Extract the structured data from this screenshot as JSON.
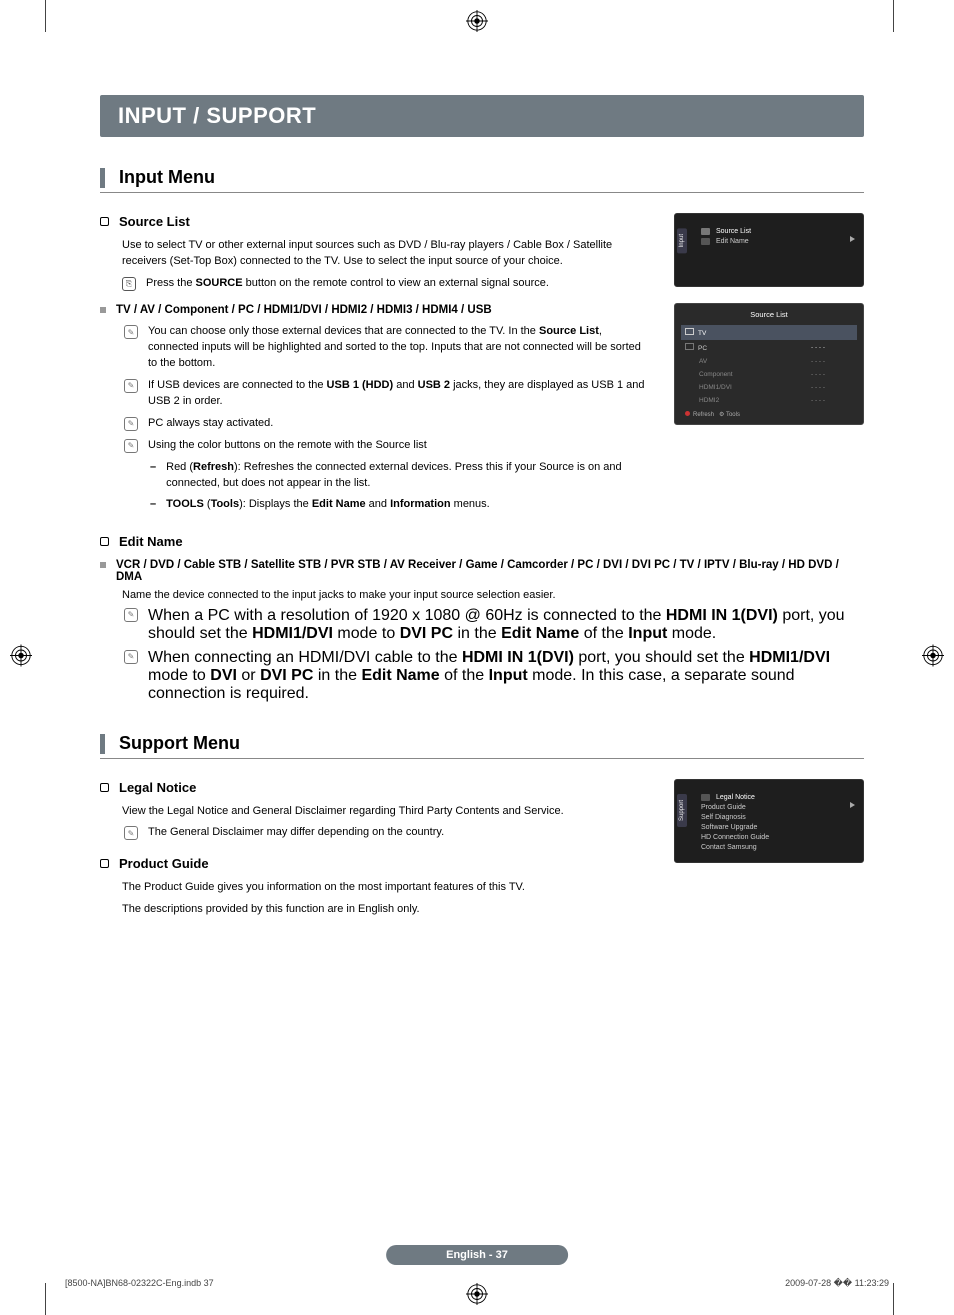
{
  "chapter_title": "INPUT / SUPPORT",
  "section1": {
    "title": "Input Menu",
    "sub1": {
      "heading": "Source List",
      "desc": "Use to select TV or other external input sources such as DVD / Blu-ray players / Cable Box / Satellite receivers (Set-Top Box) connected to the TV. Use to select the input source of your choice.",
      "press_prefix": "Press the ",
      "press_bold": "SOURCE",
      "press_suffix": " button on the remote control to view an external signal source."
    },
    "sub2": {
      "heading": "TV / AV / Component / PC / HDMI1/DVI / HDMI2 / HDMI3 / HDMI4 / USB",
      "n1a": "You can choose only those external devices that are connected to the TV. In the ",
      "n1b": "Source List",
      "n1c": ", connected inputs will be highlighted and sorted to the top. Inputs that are not connected will be sorted to the bottom.",
      "n2a": "If USB devices are connected to the ",
      "n2b": "USB 1 (HDD)",
      "n2c": " and ",
      "n2d": "USB 2",
      "n2e": " jacks, they are displayed as USB 1 and USB 2 in order.",
      "n3": "PC always stay activated.",
      "n4": "Using the color buttons on the remote with the Source list",
      "d1a": "Red (",
      "d1b": "Refresh",
      "d1c": "): Refreshes the connected external devices. Press this if your Source is on and connected, but does not appear in the list.",
      "d2a": "TOOLS",
      "d2b": " (",
      "d2c": "Tools",
      "d2d": "): Displays the ",
      "d2e": "Edit Name",
      "d2f": " and ",
      "d2g": "Information",
      "d2h": " menus."
    },
    "sub3": {
      "heading": "Edit Name",
      "list_heading": "VCR / DVD / Cable STB / Satellite STB / PVR STB / AV Receiver / Game / Camcorder / PC / DVI / DVI PC / TV / IPTV / Blu-ray / HD DVD / DMA",
      "desc": "Name the device connected to the input jacks to make your input source selection easier.",
      "n1": "When a PC with a resolution of 1920 x 1080 @ 60Hz is connected to the <b>HDMI IN 1(DVI)</b> port, you should set the <b>HDMI1/DVI</b> mode to <b>DVI PC</b> in the <b>Edit Name</b> of the <b>Input</b> mode.",
      "n2": "When connecting an HDMI/DVI cable to the <b>HDMI IN 1(DVI)</b> port, you should set the <b>HDMI1/DVI</b> mode to <b>DVI</b> or <b>DVI PC</b> in the <b>Edit Name</b> of the <b>Input</b> mode. In this case, a separate sound connection is required."
    }
  },
  "section2": {
    "title": "Support Menu",
    "sub1": {
      "heading": "Legal Notice",
      "desc": "View the Legal Notice and General Disclaimer regarding Third Party Contents and Service.",
      "note": "The General Disclaimer may differ depending on the country."
    },
    "sub2": {
      "heading": "Product Guide",
      "l1": "The Product Guide gives you information on the most important features of this TV.",
      "l2": "The descriptions provided by this function are in English only."
    }
  },
  "osd1": {
    "tab": "Input",
    "row1": "Source List",
    "row2": "Edit Name"
  },
  "osd2": {
    "title": "Source List",
    "rows": [
      {
        "label": "TV",
        "val": ""
      },
      {
        "label": "PC",
        "val": "- - - -"
      },
      {
        "label": "AV",
        "val": "- - - -"
      },
      {
        "label": "Component",
        "val": "- - - -"
      },
      {
        "label": "HDMI1/DVI",
        "val": "- - - -"
      },
      {
        "label": "HDMI2",
        "val": "- - - -"
      }
    ],
    "footer_refresh": "Refresh",
    "footer_tools": "Tools"
  },
  "osd3": {
    "tab": "Support",
    "rows": [
      "Legal Notice",
      "Product Guide",
      "Self Diagnosis",
      "Software Upgrade",
      "HD Connection Guide",
      "Contact Samsung"
    ]
  },
  "page_footer": "English - 37",
  "doc_footer_left": "[8500-NA]BN68-02322C-Eng.indb   37",
  "doc_footer_right": "2009-07-28   �� 11:23:29"
}
